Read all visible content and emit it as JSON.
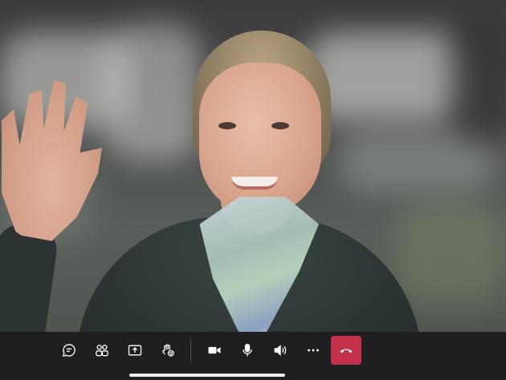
{
  "call": {
    "participant_video": "participant-video-feed"
  },
  "controls": {
    "buttons": [
      {
        "name": "chat",
        "icon": "chat-icon"
      },
      {
        "name": "participants",
        "icon": "people-icon"
      },
      {
        "name": "share",
        "icon": "share-screen-icon"
      },
      {
        "name": "reactions",
        "icon": "raise-hand-icon"
      },
      {
        "name": "camera",
        "icon": "video-camera-icon"
      },
      {
        "name": "microphone",
        "icon": "microphone-icon"
      },
      {
        "name": "speaker",
        "icon": "speaker-icon"
      },
      {
        "name": "more",
        "icon": "more-icon"
      },
      {
        "name": "hang-up",
        "icon": "hang-up-icon"
      }
    ],
    "icon_color": "#ffffff",
    "bar_color": "#1f1f21",
    "hangup_color": "#c4314b"
  }
}
